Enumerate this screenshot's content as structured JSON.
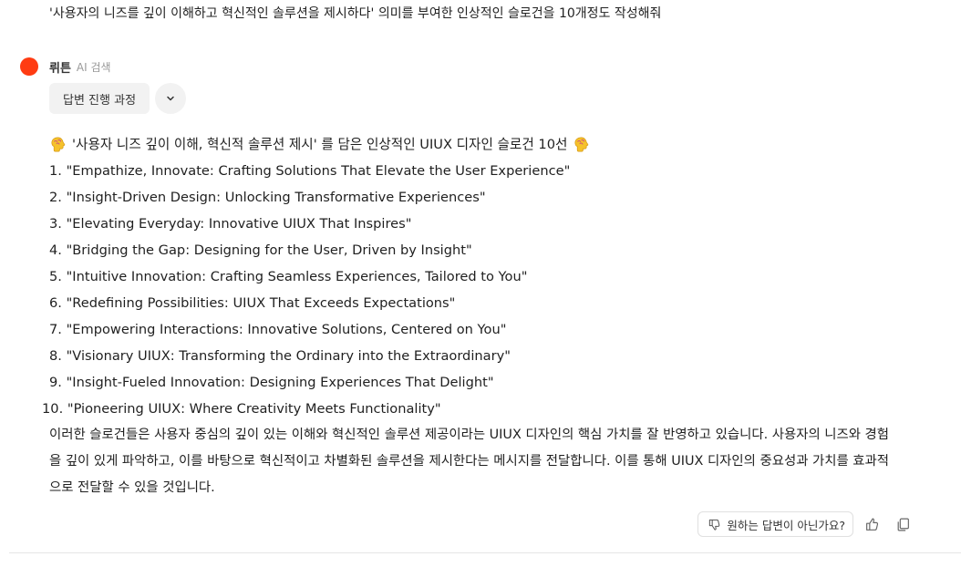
{
  "question": "'사용자의 니즈를 깊이 이해하고 혁신적인 솔루션을 제시하다' 의미를 부여한 인상적인 슬로건을 10개정도 작성해줘",
  "bot": {
    "name": "뤼튼",
    "tag": "AI 검색",
    "avatar_color": "#ff3b12",
    "process_button_label": "답변 진행 과정",
    "expand_icon": "chevron-down-icon"
  },
  "answer": {
    "title_icon": "brain-emoji-icon",
    "title": "'사용자 니즈 깊이 이해, 혁신적 솔루션 제시' 를 담은 인상적인 UIUX 디자인 슬로건 10선",
    "slogans": [
      {
        "num": "1.",
        "text": "\"Empathize, Innovate: Crafting Solutions That Elevate the User Experience\""
      },
      {
        "num": "2.",
        "text": "\"Insight-Driven Design: Unlocking Transformative Experiences\""
      },
      {
        "num": "3.",
        "text": "\"Elevating Everyday: Innovative UIUX That Inspires\""
      },
      {
        "num": "4.",
        "text": "\"Bridging the Gap: Designing for the User, Driven by Insight\""
      },
      {
        "num": "5.",
        "text": "\"Intuitive Innovation: Crafting Seamless Experiences, Tailored to You\""
      },
      {
        "num": "6.",
        "text": "\"Redefining Possibilities: UIUX That Exceeds Expectations\""
      },
      {
        "num": "7.",
        "text": "\"Empowering Interactions: Innovative Solutions, Centered on You\""
      },
      {
        "num": "8.",
        "text": "\"Visionary UIUX: Transforming the Ordinary into the Extraordinary\""
      },
      {
        "num": "9.",
        "text": "\"Insight-Fueled Innovation: Designing Experiences That Delight\""
      },
      {
        "num": "10.",
        "text": "\"Pioneering UIUX: Where Creativity Meets Functionality\""
      }
    ],
    "summary_lines": [
      "이러한 슬로건들은 사용자 중심의 깊이 있는 이해와 혁신적인 솔루션 제공이라는 UIUX 디자인의 핵심 가치를 잘 반영하고 있습니다. 사용자의 니즈와 경험",
      "을 깊이 있게 파악하고, 이를 바탕으로 혁신적이고 차별화된 솔루션을 제시한다는 메시지를 전달합니다. 이를 통해 UIUX 디자인의 중요성과 가치를 효과적",
      "으로 전달할 수 있을 것입니다."
    ]
  },
  "feedback": {
    "not_wanted_label": "원하는 답변이 아닌가요?",
    "not_wanted_icon": "thumbs-down-icon",
    "like_icon": "thumbs-up-icon",
    "copy_icon": "copy-icon"
  }
}
